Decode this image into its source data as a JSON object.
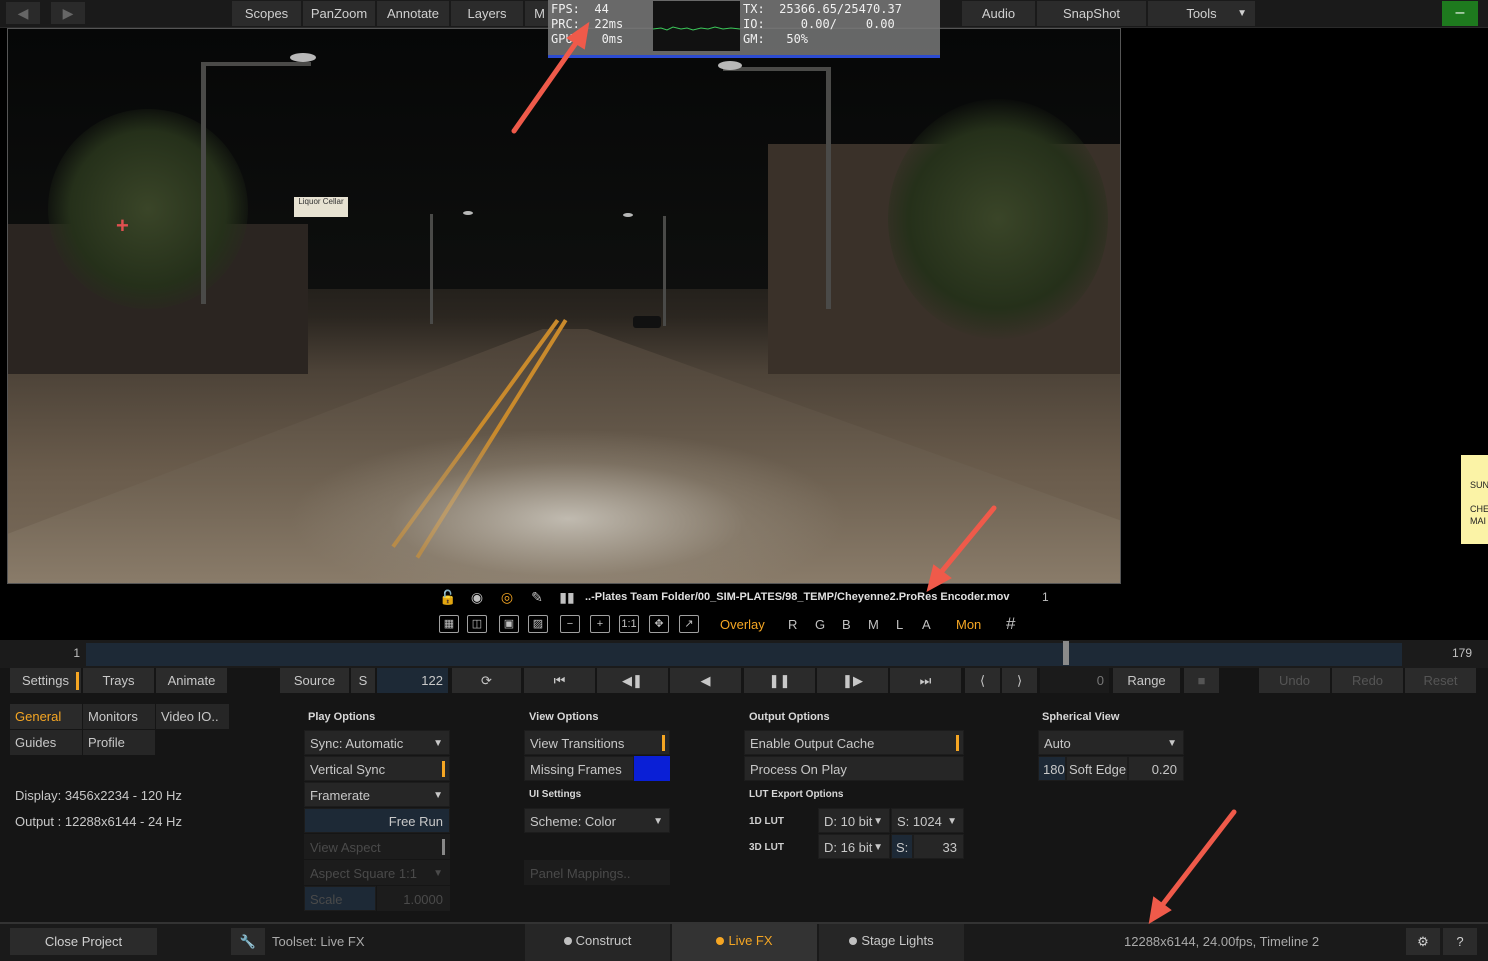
{
  "topbar": {
    "back_icon": "arrow-left-icon",
    "forward_icon": "arrow-right-icon",
    "items": [
      "Scopes",
      "PanZoom",
      "Annotate",
      "Layers",
      "M"
    ],
    "right_items": [
      "Audio",
      "SnapShot",
      "Tools"
    ],
    "tools_arrow": "▼",
    "min_label": "–"
  },
  "stats": {
    "fps": "FPS:  44",
    "prc": "PRC:  22ms",
    "gpu": "GPU:   0ms",
    "tx": "TX:  25366.65/25470.37",
    "io": "IO:     0.00/    0.00",
    "gm": "GM:   50%"
  },
  "viewer": {
    "sign_text": "Liquor Cellar"
  },
  "note": {
    "lines": [
      "SUN",
      "CHE",
      "MAI"
    ]
  },
  "filebar": {
    "path": "..-Plates Team Folder/00_SIM-PLATES/98_TEMP/Cheyenne2.ProRes Encoder.mov",
    "frame": "1"
  },
  "viewbar": {
    "overlay": "Overlay",
    "channels": [
      "R",
      "G",
      "B",
      "M",
      "L",
      "A"
    ],
    "mon": "Mon",
    "grid_icon": "#",
    "one_to_one": "1:1"
  },
  "timeline": {
    "start": "1",
    "end": "179",
    "playhead_fraction": 0.7446
  },
  "transport": {
    "settings": "Settings",
    "trays": "Trays",
    "animate": "Animate",
    "source": "Source",
    "s": "S",
    "frame": "122",
    "in_value": "0",
    "range": "Range",
    "undo": "Undo",
    "redo": "Redo",
    "reset": "Reset"
  },
  "left_tabs": {
    "general": "General",
    "monitors": "Monitors",
    "video_io": "Video IO..",
    "guides": "Guides",
    "profile": "Profile",
    "display": "Display: 3456x2234 - 120 Hz",
    "output": "Output : 12288x6144 - 24 Hz"
  },
  "play_options": {
    "header": "Play Options",
    "sync": "Sync: Automatic",
    "vertical_sync": "Vertical Sync",
    "framerate": "Framerate",
    "free_run": "Free Run",
    "view_aspect": "View Aspect",
    "aspect_square": "Aspect Square 1:1",
    "scale_label": "Scale",
    "scale_value": "1.0000"
  },
  "view_options": {
    "header": "View Options",
    "view_transitions": "View Transitions",
    "missing_frames": "Missing Frames",
    "missing_color": "#0a1fd6",
    "ui_header": "UI Settings",
    "scheme": "Scheme: Color",
    "panel_mappings": "Panel Mappings.."
  },
  "output_options": {
    "header": "Output Options",
    "enable_cache": "Enable Output Cache",
    "process_on_play": "Process On Play",
    "lut_header": "LUT Export Options",
    "lut1d": "1D LUT",
    "lut1d_depth": "D: 10 bit",
    "lut1d_size": "S: 1024",
    "lut3d": "3D LUT",
    "lut3d_depth": "D: 16 bit",
    "lut3d_size_label": "S:",
    "lut3d_size": "33"
  },
  "spherical": {
    "header": "Spherical View",
    "mode": "Auto",
    "angle": "180",
    "soft_edge": "Soft Edge",
    "soft_value": "0.20"
  },
  "statusbar": {
    "close_project": "Close Project",
    "toolset": "Toolset: Live FX",
    "tabs": [
      "Construct",
      "Live FX",
      "Stage Lights"
    ],
    "info": "12288x6144, 24.00fps, Timeline 2",
    "help": "?"
  },
  "colors": {
    "accent": "#f5a623",
    "annotation_arrow": "#ef5a4a"
  }
}
